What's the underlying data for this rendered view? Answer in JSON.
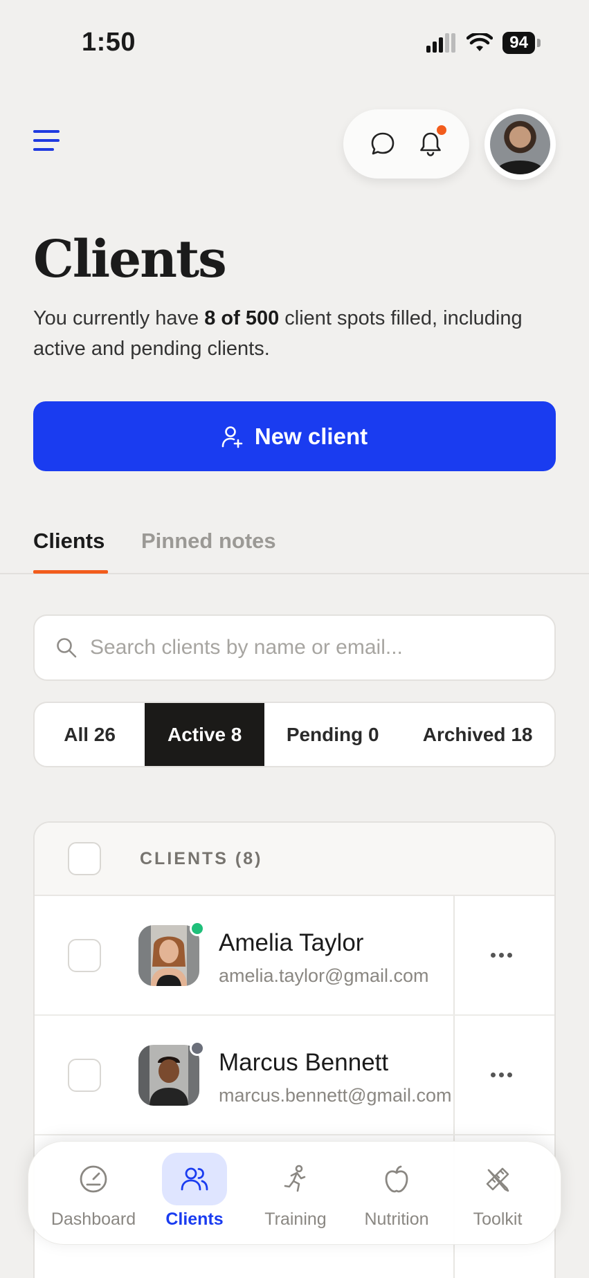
{
  "status_bar": {
    "time": "1:50",
    "battery": "94"
  },
  "header": {
    "menu_icon": "hamburger-menu-icon",
    "chat_icon": "chat-bubble-icon",
    "bell_icon": "bell-icon",
    "notification_dot_color": "#f25c1c"
  },
  "page": {
    "title": "Clients",
    "desc_pre": "You currently have ",
    "desc_strong": "8 of 500",
    "desc_post": " client spots filled, including active and pending clients."
  },
  "new_client_button": {
    "label": "New client",
    "icon": "user-plus-icon",
    "color": "#1a3cf0"
  },
  "tabs": [
    {
      "label": "Clients",
      "active": true
    },
    {
      "label": "Pinned notes",
      "active": false
    }
  ],
  "search": {
    "placeholder": "Search clients by name or email...",
    "value": ""
  },
  "filters": [
    {
      "label": "All 26",
      "selected": false
    },
    {
      "label": "Active 8",
      "selected": true
    },
    {
      "label": "Pending 0",
      "selected": false
    },
    {
      "label": "Archived 18",
      "selected": false
    }
  ],
  "table": {
    "header": "CLIENTS (8)",
    "rows": [
      {
        "name": "Amelia Taylor",
        "email": "amelia.taylor@gmail.com",
        "status_color": "#1fbf7a",
        "more_icon": "more-horizontal-icon"
      },
      {
        "name": "Marcus Bennett",
        "email": "marcus.bennett@gmail.com",
        "status_color": "#6b6f7a",
        "more_icon": "more-horizontal-icon"
      }
    ]
  },
  "bottom_nav": [
    {
      "label": "Dashboard",
      "icon": "gauge-icon",
      "active": false
    },
    {
      "label": "Clients",
      "icon": "users-icon",
      "active": true
    },
    {
      "label": "Training",
      "icon": "running-person-icon",
      "active": false
    },
    {
      "label": "Nutrition",
      "icon": "apple-icon",
      "active": false
    },
    {
      "label": "Toolkit",
      "icon": "pencil-ruler-icon",
      "active": false
    }
  ]
}
